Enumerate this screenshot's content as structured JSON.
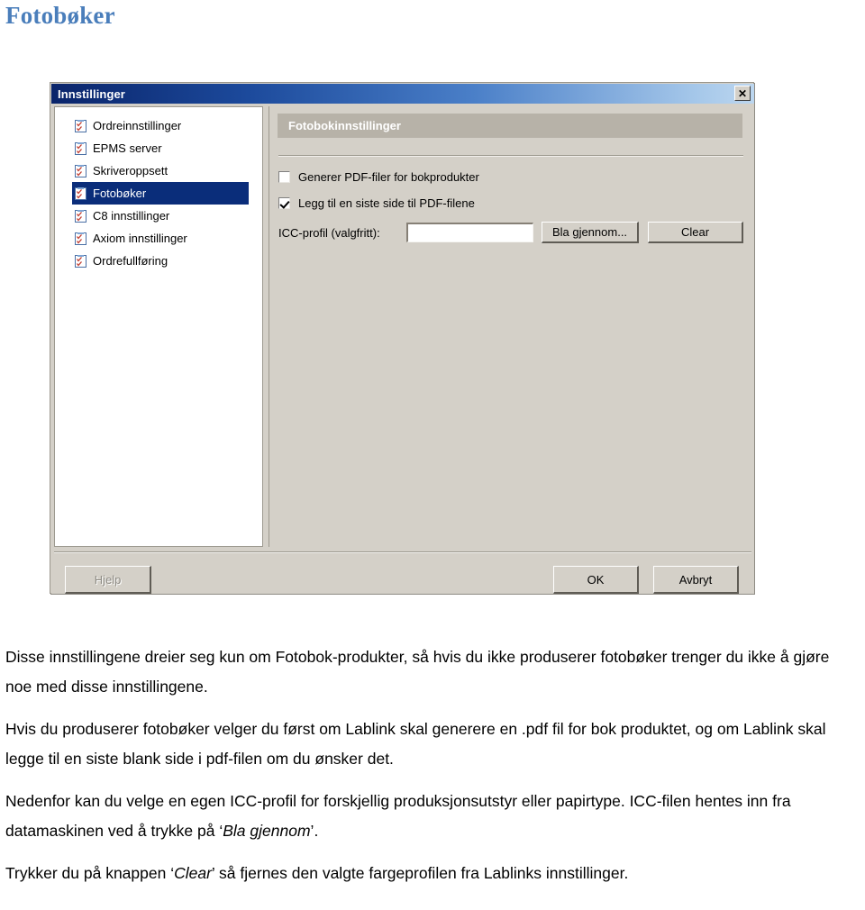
{
  "page": {
    "title": "Fotøbker_placeholder"
  },
  "heading": "Fotobøker",
  "dialog": {
    "title": "Innstillinger",
    "close_label": "✕",
    "tree": {
      "items": [
        {
          "label": "Ordreinnstillinger",
          "icon": "checklist-icon",
          "selected": false
        },
        {
          "label": "EPMS server",
          "icon": "checklist-icon",
          "selected": false
        },
        {
          "label": "Skriveroppsett",
          "icon": "checklist-icon",
          "selected": false
        },
        {
          "label": "Fotobøker",
          "icon": "checklist-icon",
          "selected": true
        },
        {
          "label": "C8 innstillinger",
          "icon": "checklist-icon",
          "selected": false
        },
        {
          "label": "Axiom innstillinger",
          "icon": "checklist-icon",
          "selected": false
        },
        {
          "label": "Ordrefullføring",
          "icon": "checklist-icon",
          "selected": false
        }
      ]
    },
    "panel": {
      "header": "Fotobokinnstillinger",
      "checkbox_generate_pdf": {
        "label": "Generer PDF-filer for bokprodukter",
        "checked": false
      },
      "checkbox_add_last_page": {
        "label": "Legg til en siste side til PDF-filene",
        "checked": true
      },
      "icc_label": "ICC-profil (valgfritt):",
      "icc_value": "",
      "icc_placeholder": "",
      "browse_button": "Bla gjennom...",
      "clear_button": "Clear"
    },
    "footer": {
      "help_button": "Hjelp",
      "ok_button": "OK",
      "cancel_button": "Avbryt"
    },
    "colors": {
      "titlebar_start": "#0a246a",
      "titlebar_end": "#bcd6ef",
      "dialog_face": "#d4d0c8",
      "selection": "#0a2d7a",
      "panel_header": "#b7b2a8",
      "heading_blue": "#4a7ebb"
    }
  },
  "body_text": {
    "p1": "Disse innstillingene dreier seg kun om Fotobok-produkter, så hvis du ikke produserer fotobøker trenger du ikke å gjøre noe med disse innstillingene.",
    "p2_a": "Hvis du produserer fotobøker velger du først om Lablink skal generere en .pdf fil for bok produktet, og  om Lablink skal legge til en siste blank side i pdf-filen om du ønsker det.",
    "p3_a": "Nedenfor kan du velge en egen ICC-profil for forskjellig produksjonsutstyr eller papirtype. ICC-filen hentes inn fra datamaskinen ved å trykke på ",
    "p3_em": "Bla gjennom",
    "p3_b": ".",
    "p4_a": "Trykker du på knappen ",
    "p4_em": "Clear",
    "p4_b": " så fjernes den valgte fargeprofilen fra Lablinks innstillinger.",
    "quote_open": "‘",
    "quote_close": "’"
  }
}
